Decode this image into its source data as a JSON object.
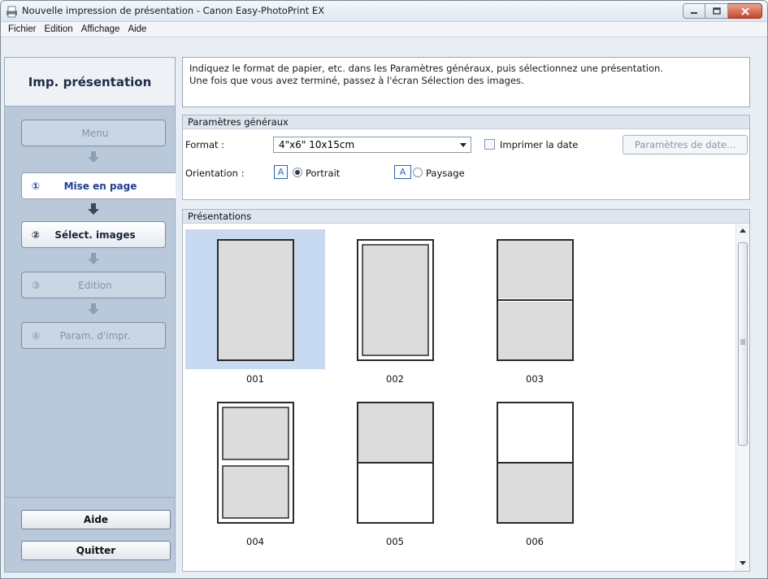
{
  "window": {
    "title": "Nouvelle impression de présentation - Canon Easy-PhotoPrint EX"
  },
  "menu": [
    "Fichier",
    "Edition",
    "Affichage",
    "Aide"
  ],
  "sidebar": {
    "title": "Imp. présentation",
    "steps": [
      {
        "num": "",
        "label": "Menu"
      },
      {
        "num": "①",
        "label": "Mise en page"
      },
      {
        "num": "②",
        "label": "Sélect. images"
      },
      {
        "num": "③",
        "label": "Edition"
      },
      {
        "num": "④",
        "label": "Param. d'impr."
      }
    ],
    "help_label": "Aide",
    "quit_label": "Quitter"
  },
  "instructions": {
    "line1": "Indiquez le format de papier, etc. dans les Paramètres généraux, puis sélectionnez une présentation.",
    "line2": "Une fois que vous avez terminé, passez à l'écran Sélection des images."
  },
  "general": {
    "header": "Paramètres généraux",
    "format_label": "Format :",
    "format_value": "4\"x6\" 10x15cm",
    "print_date_label": "Imprimer la date",
    "print_date_checked": false,
    "date_settings_label": "Paramètres de date...",
    "orientation_label": "Orientation :",
    "orientation_icon_letter": "A",
    "portrait_label": "Portrait",
    "landscape_label": "Paysage",
    "selected_orientation": "Portrait"
  },
  "presentations": {
    "header": "Présentations",
    "selected": "001",
    "items": [
      {
        "id": "001"
      },
      {
        "id": "002"
      },
      {
        "id": "003"
      },
      {
        "id": "004"
      },
      {
        "id": "005"
      },
      {
        "id": "006"
      }
    ]
  },
  "colors": {
    "accent_blue": "#1f3fa0",
    "selection": "#c7daf1",
    "panel": "#bac9da",
    "photo_fill": "#dcdcdc"
  }
}
